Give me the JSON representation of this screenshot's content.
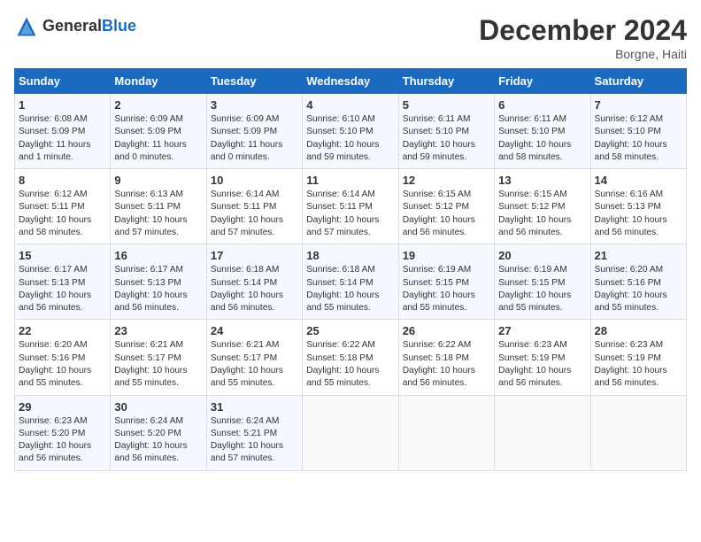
{
  "logo": {
    "text_general": "General",
    "text_blue": "Blue"
  },
  "title": "December 2024",
  "location": "Borgne, Haiti",
  "days_of_week": [
    "Sunday",
    "Monday",
    "Tuesday",
    "Wednesday",
    "Thursday",
    "Friday",
    "Saturday"
  ],
  "weeks": [
    [
      {
        "day": "1",
        "sunrise": "6:08 AM",
        "sunset": "5:09 PM",
        "daylight": "11 hours and 1 minute."
      },
      {
        "day": "2",
        "sunrise": "6:09 AM",
        "sunset": "5:09 PM",
        "daylight": "11 hours and 0 minutes."
      },
      {
        "day": "3",
        "sunrise": "6:09 AM",
        "sunset": "5:09 PM",
        "daylight": "11 hours and 0 minutes."
      },
      {
        "day": "4",
        "sunrise": "6:10 AM",
        "sunset": "5:10 PM",
        "daylight": "10 hours and 59 minutes."
      },
      {
        "day": "5",
        "sunrise": "6:11 AM",
        "sunset": "5:10 PM",
        "daylight": "10 hours and 59 minutes."
      },
      {
        "day": "6",
        "sunrise": "6:11 AM",
        "sunset": "5:10 PM",
        "daylight": "10 hours and 58 minutes."
      },
      {
        "day": "7",
        "sunrise": "6:12 AM",
        "sunset": "5:10 PM",
        "daylight": "10 hours and 58 minutes."
      }
    ],
    [
      {
        "day": "8",
        "sunrise": "6:12 AM",
        "sunset": "5:11 PM",
        "daylight": "10 hours and 58 minutes."
      },
      {
        "day": "9",
        "sunrise": "6:13 AM",
        "sunset": "5:11 PM",
        "daylight": "10 hours and 57 minutes."
      },
      {
        "day": "10",
        "sunrise": "6:14 AM",
        "sunset": "5:11 PM",
        "daylight": "10 hours and 57 minutes."
      },
      {
        "day": "11",
        "sunrise": "6:14 AM",
        "sunset": "5:11 PM",
        "daylight": "10 hours and 57 minutes."
      },
      {
        "day": "12",
        "sunrise": "6:15 AM",
        "sunset": "5:12 PM",
        "daylight": "10 hours and 56 minutes."
      },
      {
        "day": "13",
        "sunrise": "6:15 AM",
        "sunset": "5:12 PM",
        "daylight": "10 hours and 56 minutes."
      },
      {
        "day": "14",
        "sunrise": "6:16 AM",
        "sunset": "5:13 PM",
        "daylight": "10 hours and 56 minutes."
      }
    ],
    [
      {
        "day": "15",
        "sunrise": "6:17 AM",
        "sunset": "5:13 PM",
        "daylight": "10 hours and 56 minutes."
      },
      {
        "day": "16",
        "sunrise": "6:17 AM",
        "sunset": "5:13 PM",
        "daylight": "10 hours and 56 minutes."
      },
      {
        "day": "17",
        "sunrise": "6:18 AM",
        "sunset": "5:14 PM",
        "daylight": "10 hours and 56 minutes."
      },
      {
        "day": "18",
        "sunrise": "6:18 AM",
        "sunset": "5:14 PM",
        "daylight": "10 hours and 55 minutes."
      },
      {
        "day": "19",
        "sunrise": "6:19 AM",
        "sunset": "5:15 PM",
        "daylight": "10 hours and 55 minutes."
      },
      {
        "day": "20",
        "sunrise": "6:19 AM",
        "sunset": "5:15 PM",
        "daylight": "10 hours and 55 minutes."
      },
      {
        "day": "21",
        "sunrise": "6:20 AM",
        "sunset": "5:16 PM",
        "daylight": "10 hours and 55 minutes."
      }
    ],
    [
      {
        "day": "22",
        "sunrise": "6:20 AM",
        "sunset": "5:16 PM",
        "daylight": "10 hours and 55 minutes."
      },
      {
        "day": "23",
        "sunrise": "6:21 AM",
        "sunset": "5:17 PM",
        "daylight": "10 hours and 55 minutes."
      },
      {
        "day": "24",
        "sunrise": "6:21 AM",
        "sunset": "5:17 PM",
        "daylight": "10 hours and 55 minutes."
      },
      {
        "day": "25",
        "sunrise": "6:22 AM",
        "sunset": "5:18 PM",
        "daylight": "10 hours and 55 minutes."
      },
      {
        "day": "26",
        "sunrise": "6:22 AM",
        "sunset": "5:18 PM",
        "daylight": "10 hours and 56 minutes."
      },
      {
        "day": "27",
        "sunrise": "6:23 AM",
        "sunset": "5:19 PM",
        "daylight": "10 hours and 56 minutes."
      },
      {
        "day": "28",
        "sunrise": "6:23 AM",
        "sunset": "5:19 PM",
        "daylight": "10 hours and 56 minutes."
      }
    ],
    [
      {
        "day": "29",
        "sunrise": "6:23 AM",
        "sunset": "5:20 PM",
        "daylight": "10 hours and 56 minutes."
      },
      {
        "day": "30",
        "sunrise": "6:24 AM",
        "sunset": "5:20 PM",
        "daylight": "10 hours and 56 minutes."
      },
      {
        "day": "31",
        "sunrise": "6:24 AM",
        "sunset": "5:21 PM",
        "daylight": "10 hours and 57 minutes."
      },
      null,
      null,
      null,
      null
    ]
  ],
  "labels": {
    "sunrise": "Sunrise:",
    "sunset": "Sunset:",
    "daylight": "Daylight:"
  }
}
